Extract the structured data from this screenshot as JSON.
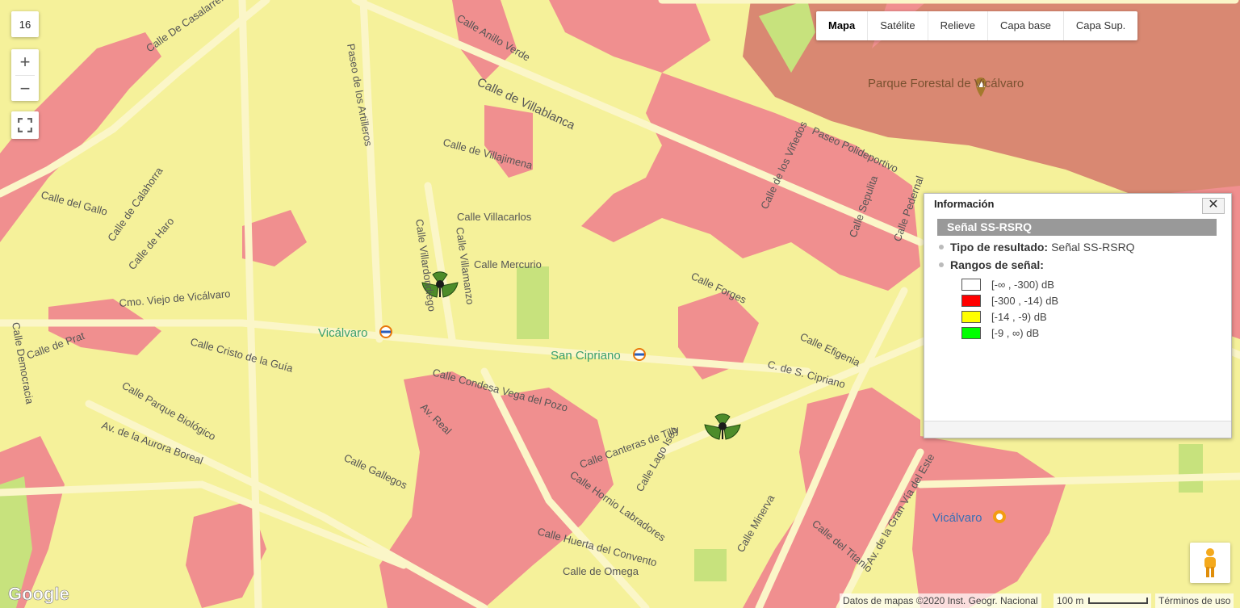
{
  "map": {
    "zoom_level": "16",
    "zoom_in": "+",
    "zoom_out": "−",
    "map_types": [
      "Mapa",
      "Satélite",
      "Relieve",
      "Capa base",
      "Capa Sup."
    ],
    "active_map_type": "Mapa",
    "street_labels": [
      "Calle De Casalarreina",
      "Calle Anillo Verde",
      "Paseo de los Artilleros",
      "Calle de Villablanca",
      "Calle de Villajimena",
      "Calle Villacarlos",
      "Calle Mercurio",
      "Calle Villardondiego",
      "Calle Villamanzo",
      "Cmo. Viejo de Vicálvaro",
      "Calle Cristo de la Guía",
      "Calle de Prat",
      "Calle Parque Biológico",
      "Av. de la Aurora Boreal",
      "Calle Gallegos",
      "Calle Condesa Vega del Pozo",
      "Av. Real",
      "Calle Canteras de Tilly",
      "Calle Lago Iseo",
      "Calle Hornio Labradores",
      "Calle Huerta del Convento",
      "Calle de Omega",
      "Calle Minerva",
      "Calle del Titanio",
      "Av. de la Gran Vía del Este",
      "Calle Efigenia",
      "C. de S. Cipriano",
      "Calle de los Viñedos",
      "Paseo Polideportivo",
      "Calle Sepulita",
      "Calle Forges",
      "Calle del Gallo",
      "Calle de Calahorra",
      "Calle de Haro",
      "Calle Democracia",
      "Calle Pedernal"
    ],
    "poi_labels": {
      "park": "Parque Forestal de Vicálvaro",
      "metro_vicalvaro": "Vicálvaro",
      "metro_san_cipriano": "San Cipriano",
      "station_vicalvaro": "Vicálvaro"
    },
    "logo": "Google",
    "attribution": "Datos de mapas ©2020 Inst. Geogr. Nacional",
    "scale": "100 m",
    "terms": "Términos de uso"
  },
  "info_window": {
    "title": "Información",
    "close": "✕",
    "section": "Señal SS-RSRQ",
    "result_type_label": "Tipo de resultado:",
    "result_type_value": "Señal SS-RSRQ",
    "ranges_label": "Rangos de señal:",
    "legend": [
      {
        "range": "[-∞ , -300) dB",
        "color": "#ffffff"
      },
      {
        "range": "[-300 , -14) dB",
        "color": "#ff0000"
      },
      {
        "range": "[-14 , -9) dB",
        "color": "#ffff00"
      },
      {
        "range": "[-9 , ∞) dB",
        "color": "#00ff00"
      }
    ]
  },
  "colors": {
    "coverage_yellow": "#f5f19a",
    "coverage_red": "#f08f8f",
    "park_brown": "#d98872",
    "road": "#fbf6c8"
  },
  "icons": [
    "antenna-icon",
    "metro-icon",
    "train-station-icon",
    "pegman-icon",
    "fullscreen-icon"
  ]
}
